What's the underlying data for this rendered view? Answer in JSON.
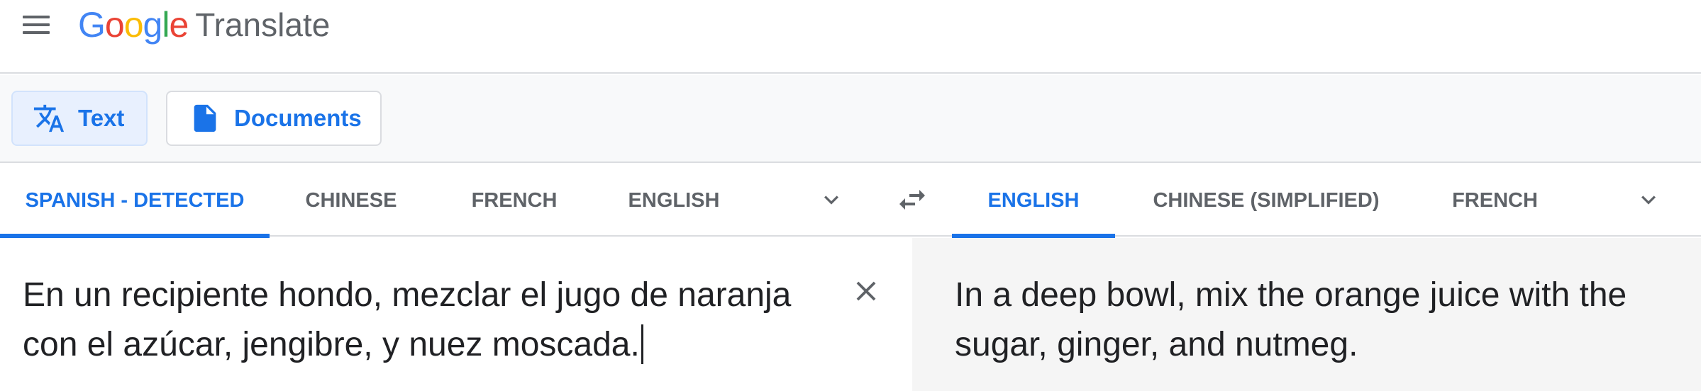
{
  "header": {
    "logo_letters": [
      {
        "ch": "G",
        "color": "#4285F4"
      },
      {
        "ch": "o",
        "color": "#EA4335"
      },
      {
        "ch": "o",
        "color": "#FBBC05"
      },
      {
        "ch": "g",
        "color": "#4285F4"
      },
      {
        "ch": "l",
        "color": "#34A853"
      },
      {
        "ch": "e",
        "color": "#EA4335"
      }
    ],
    "product_name": "Translate",
    "menu_icon": "hamburger-menu-icon"
  },
  "modes": {
    "text_label": "Text",
    "text_icon": "translate-icon",
    "documents_label": "Documents",
    "documents_icon": "document-icon",
    "active": "Text"
  },
  "source_languages": {
    "tabs": [
      "SPANISH - DETECTED",
      "CHINESE",
      "FRENCH",
      "ENGLISH"
    ],
    "active": "SPANISH - DETECTED"
  },
  "target_languages": {
    "tabs": [
      "ENGLISH",
      "CHINESE (SIMPLIFIED)",
      "FRENCH"
    ],
    "active": "ENGLISH"
  },
  "source": {
    "text": "En un recipiente hondo, mezclar el jugo de naranja con el azúcar, jengibre, y nuez moscada."
  },
  "target": {
    "text": "In a deep bowl, mix the orange juice with the sugar, ginger, and nutmeg."
  },
  "colors": {
    "accent": "#1a73e8",
    "active_mode_bg": "#e8f0fe",
    "target_pane_bg": "#f5f5f5",
    "inactive_tab_text": "#5f6368"
  },
  "icons": {
    "clear": "close-icon",
    "swap": "swap-languages-icon",
    "more_source": "chevron-down-icon",
    "more_target": "chevron-down-icon"
  }
}
